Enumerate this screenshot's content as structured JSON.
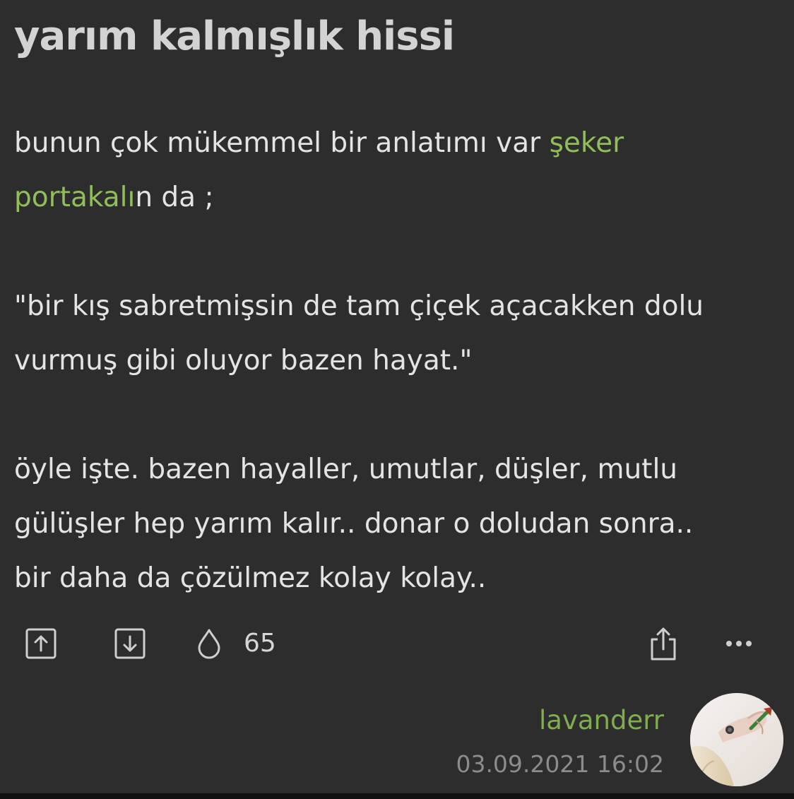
{
  "entry": {
    "title": "yarım kalmışlık hissi",
    "paragraph1": {
      "line1_text": "bunun çok mükemmel bir anlatımı var ",
      "link_part1": "şeker",
      "link_part2": "portakalı",
      "line2_rest": "n da ;"
    },
    "paragraph2": {
      "line1": "\"bir kış sabretmişsin de tam çiçek açacakken dolu",
      "line2": "vurmuş gibi oluyor bazen hayat.\""
    },
    "paragraph3": {
      "line1": "öyle işte. bazen hayaller, umutlar, düşler, mutlu",
      "line2": "gülüşler hep yarım kalır.. donar o doludan sonra..",
      "line3": "bir daha da çözülmez kolay kolay.."
    }
  },
  "actions": {
    "upvote_icon": "upvote-icon",
    "downvote_icon": "downvote-icon",
    "favorite_icon": "drop-icon",
    "favorite_count": "65",
    "share_icon": "share-icon",
    "more_icon": "more-dots-icon"
  },
  "author": {
    "name": "lavanderr",
    "date": "03.09.2021 16:02"
  },
  "colors": {
    "background": "#2d2d2d",
    "link": "#8fbe5a",
    "author": "#7fae4e",
    "date": "#8c8c8c"
  }
}
